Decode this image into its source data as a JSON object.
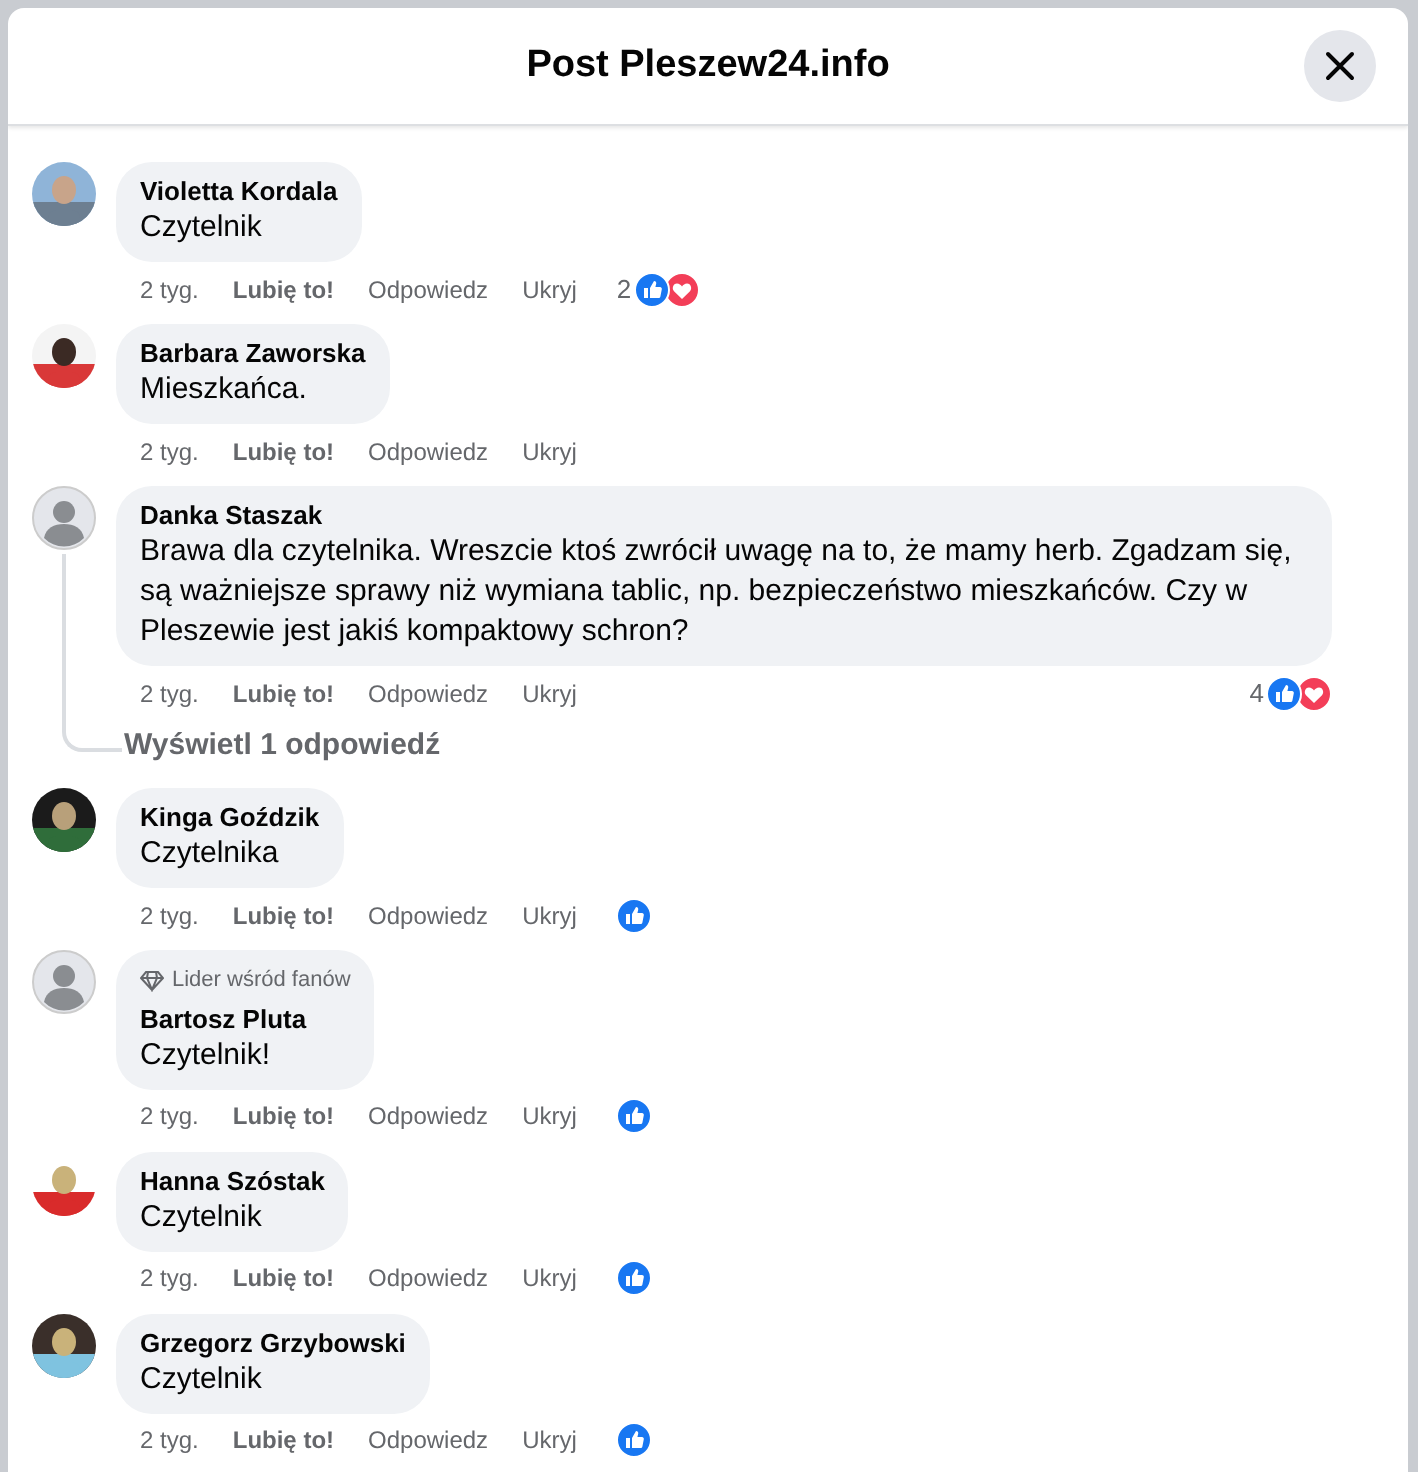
{
  "dialog": {
    "title": "Post Pleszew24.info"
  },
  "comments": [
    {
      "author": "Violetta Kordala",
      "text": "Czytelnik",
      "time": "2 tyg.",
      "like": "Lubię to!",
      "reply": "Odpowiedz",
      "hide": "Ukryj",
      "reaction_count": "2",
      "liked": true,
      "loved": true
    },
    {
      "author": "Barbara Zaworska",
      "text": "Mieszkańca.",
      "time": "2 tyg.",
      "like": "Lubię to!",
      "reply": "Odpowiedz",
      "hide": "Ukryj",
      "liked": false,
      "loved": false
    },
    {
      "author": "Danka Staszak",
      "text": "Brawa dla czytelnika. Wreszcie ktoś zwrócił uwagę na to, że mamy herb. Zgadzam się, są ważniejsze sprawy niż wymiana tablic, np. bezpieczeństwo mieszkańców. Czy w Pleszewie jest jakiś kompaktowy schron?",
      "avatar": {
        "kind": "silhouette"
      },
      "time": "2 tyg.",
      "like": "Lubię to!",
      "reply": "Odpowiedz",
      "hide": "Ukryj",
      "reaction_count": "4",
      "liked": true,
      "loved": true,
      "replies_link": "Wyświetl 1 odpowiedź"
    },
    {
      "author": "Kinga Goździk",
      "text": "Czytelnika",
      "time": "2 tyg.",
      "like": "Lubię to!",
      "reply": "Odpowiedz",
      "hide": "Ukryj",
      "liked": true,
      "loved": false
    },
    {
      "author": "Bartosz Pluta",
      "badge": "Lider wśród fanów",
      "text": "Czytelnik!",
      "avatar": {
        "kind": "silhouette"
      },
      "time": "2 tyg.",
      "like": "Lubię to!",
      "reply": "Odpowiedz",
      "hide": "Ukryj",
      "liked": true,
      "loved": false
    },
    {
      "author": "Hanna Szóstak",
      "text": "Czytelnik",
      "time": "2 tyg.",
      "like": "Lubię to!",
      "reply": "Odpowiedz",
      "hide": "Ukryj",
      "liked": true,
      "loved": false
    },
    {
      "author": "Grzegorz Grzybowski",
      "text": "Czytelnik",
      "time": "2 tyg.",
      "like": "Lubię to!",
      "reply": "Odpowiedz",
      "hide": "Ukryj",
      "liked": true,
      "loved": false
    }
  ]
}
